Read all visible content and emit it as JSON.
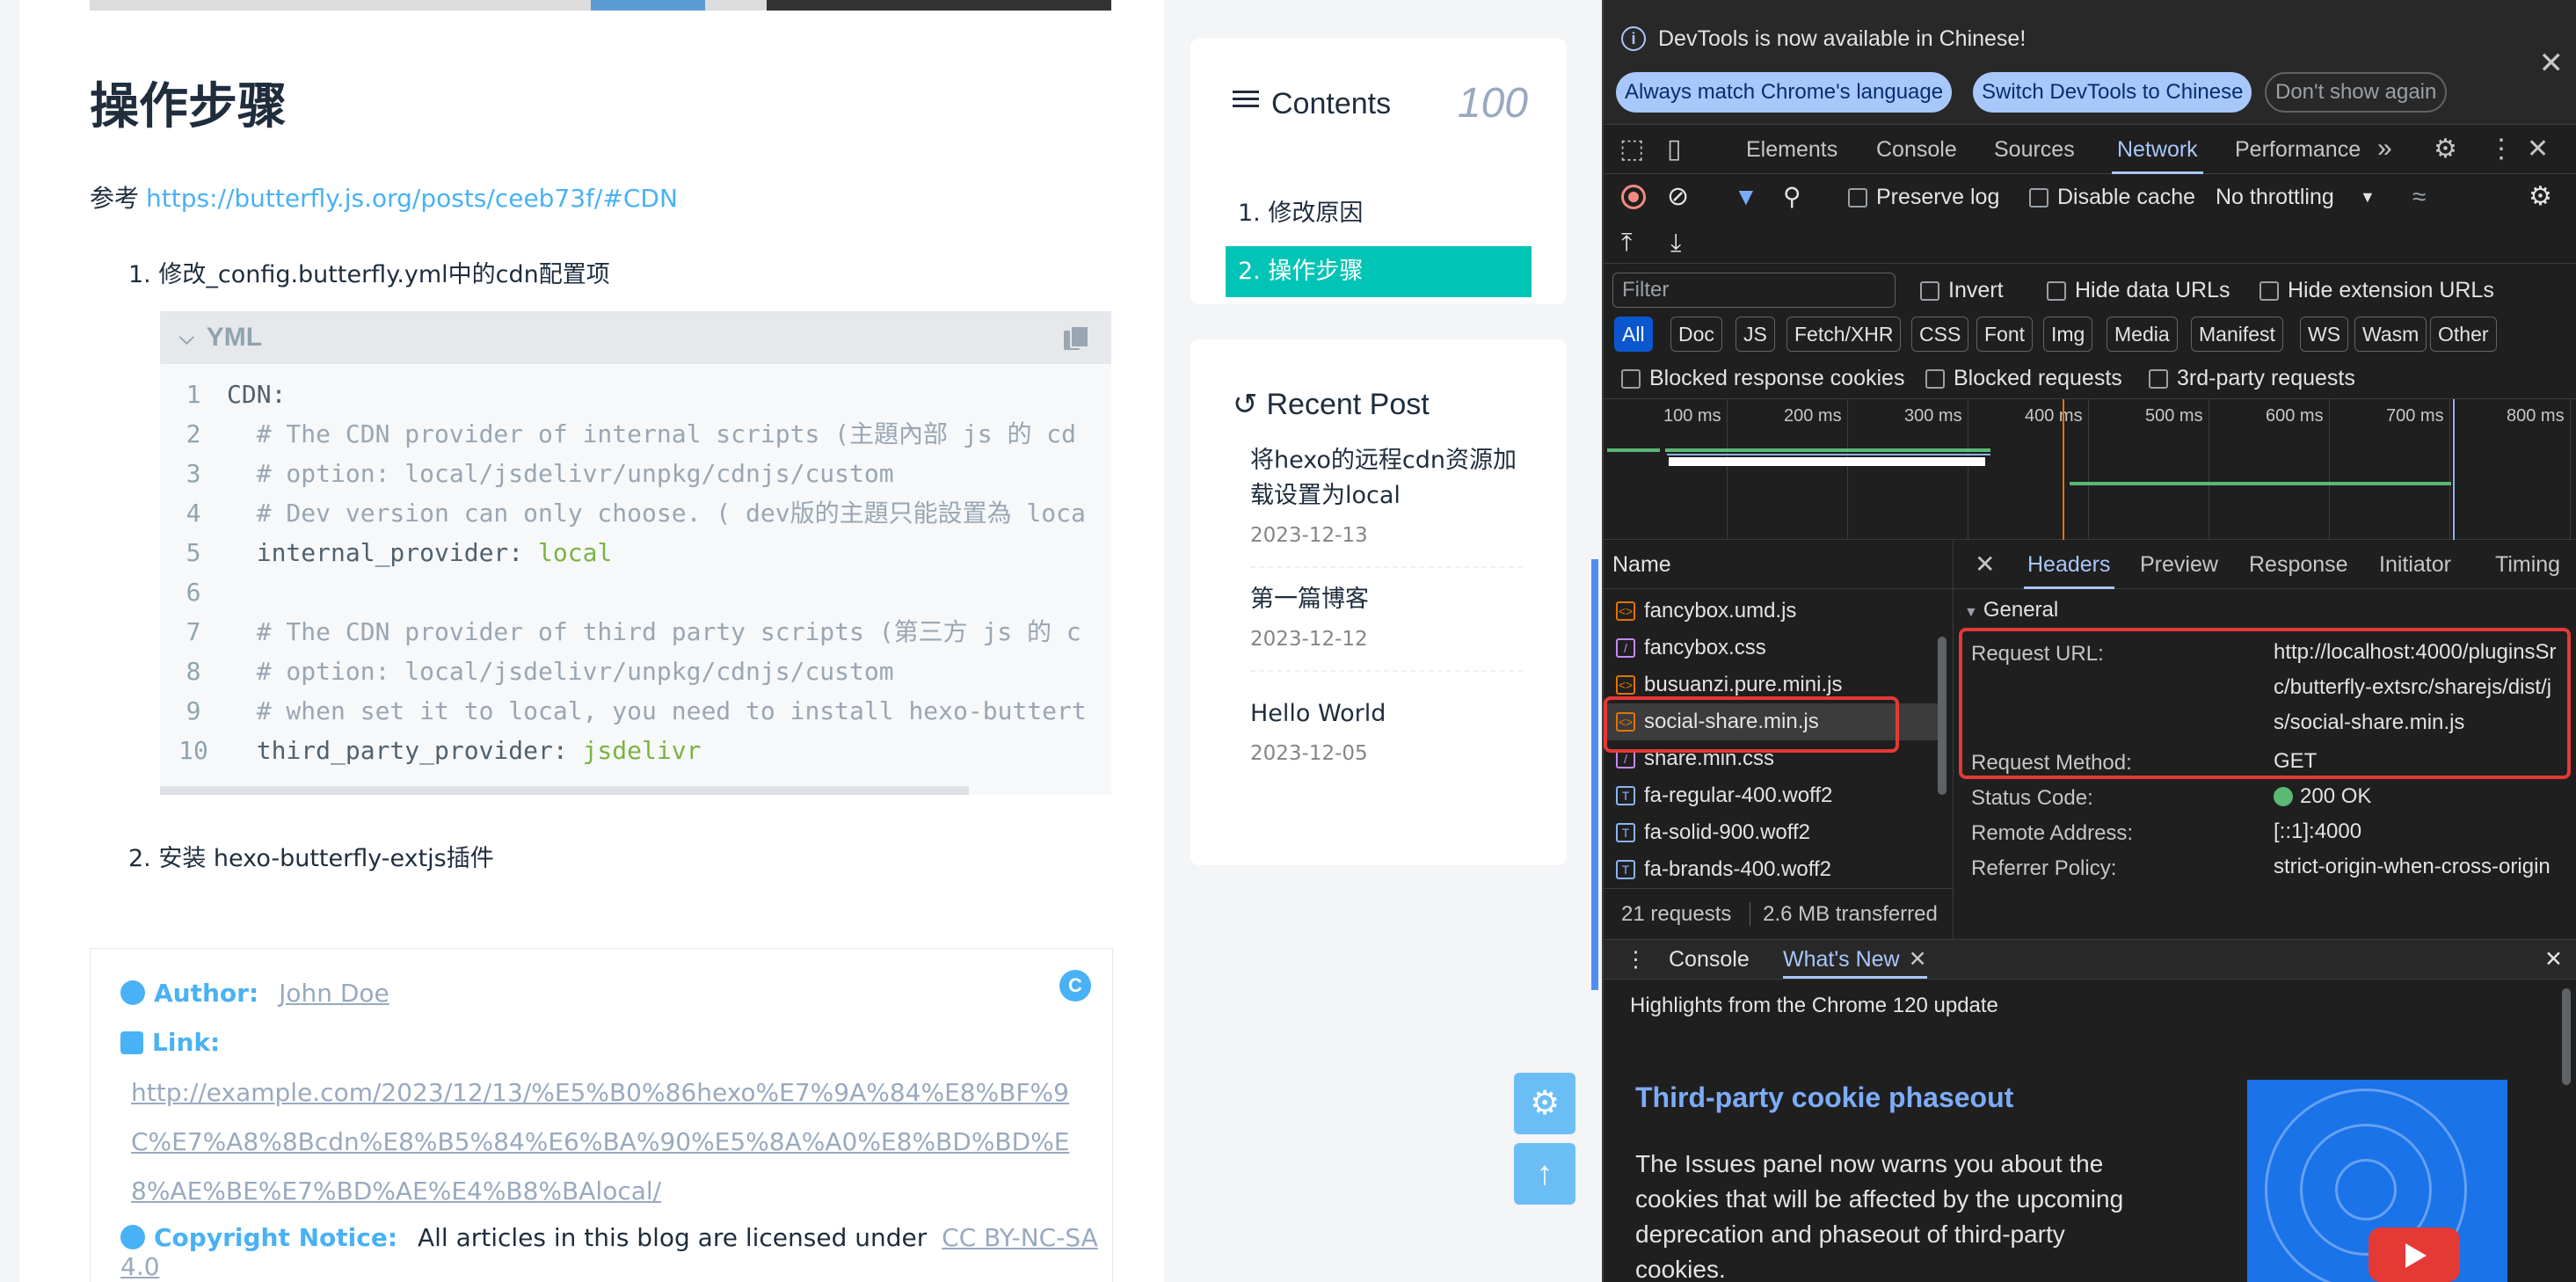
{
  "blog": {
    "heading": "操作步骤",
    "ref_prefix": "参考",
    "ref_link": "https://butterfly.js.org/posts/ceeb73f/#CDN",
    "step1": "1. 修改_config.butterfly.yml中的cdn配置项",
    "step2": "2. 安装 hexo-butterfly-extjs插件",
    "code": {
      "lang": "YML",
      "lines": [
        {
          "n": "1",
          "text": "CDN:"
        },
        {
          "n": "2",
          "text": "  # The CDN provider of internal scripts (主題內部 js 的 cd"
        },
        {
          "n": "3",
          "text": "  # option: local/jsdelivr/unpkg/cdnjs/custom"
        },
        {
          "n": "4",
          "text": "  # Dev version can only choose. ( dev版的主題只能設置為 loca"
        },
        {
          "n": "5",
          "key": "  internal_provider: ",
          "val": "local"
        },
        {
          "n": "6",
          "text": ""
        },
        {
          "n": "7",
          "text": "  # The CDN provider of third party scripts (第三方 js 的 c"
        },
        {
          "n": "8",
          "text": "  # option: local/jsdelivr/unpkg/cdnjs/custom"
        },
        {
          "n": "9",
          "text": "  # when set it to local, you need to install hexo-buttert"
        },
        {
          "n": "10",
          "key": "  third_party_provider: ",
          "val": "jsdelivr"
        }
      ]
    },
    "author_label": "Author:",
    "author_name": "John Doe",
    "link_label": "Link:",
    "link_url": "http://example.com/2023/12/13/%E5%B0%86hexo%E7%9A%84%E8%BF%9C%E7%A8%8Bcdn%E8%B5%84%E6%BA%90%E5%8A%A0%E8%BD%BD%E8%AE%BE%E7%BD%AE%E4%B8%BAlocal/",
    "copyright_label": "Copyright Notice:",
    "copyright_text": "All articles in this blog are licensed under",
    "copyright_link": "CC BY-NC-SA 4.0"
  },
  "sidebar": {
    "toc_title": "Contents",
    "toc_percent": "100",
    "toc_items": [
      "1. 修改原因",
      "2. 操作步骤"
    ],
    "recent_title": "Recent Post",
    "posts": [
      {
        "title": "将hexo的远程cdn资源加载设置为local",
        "date": "2023-12-13"
      },
      {
        "title": "第一篇博客",
        "date": "2023-12-12"
      },
      {
        "title": "Hello World",
        "date": "2023-12-05"
      }
    ]
  },
  "devtools": {
    "info_msg": "DevTools is now available in Chinese!",
    "btn_match": "Always match Chrome's language",
    "btn_switch": "Switch DevTools to Chinese",
    "btn_dont": "Don't show again",
    "tabs": [
      "Elements",
      "Console",
      "Sources",
      "Network",
      "Performance"
    ],
    "active_tab": "Network",
    "preserve_log": "Preserve log",
    "disable_cache": "Disable cache",
    "throttling": "No throttling",
    "filter_placeholder": "Filter",
    "invert": "Invert",
    "hide_data_urls": "Hide data URLs",
    "hide_ext_urls": "Hide extension URLs",
    "types": [
      "All",
      "Doc",
      "JS",
      "Fetch/XHR",
      "CSS",
      "Font",
      "Img",
      "Media",
      "Manifest",
      "WS",
      "Wasm",
      "Other"
    ],
    "blocked_cookies": "Blocked response cookies",
    "blocked_requests": "Blocked requests",
    "third_party": "3rd-party requests",
    "ticks": [
      "100 ms",
      "200 ms",
      "300 ms",
      "400 ms",
      "500 ms",
      "600 ms",
      "700 ms",
      "800 ms"
    ],
    "name_col": "Name",
    "requests": [
      {
        "name": "fancybox.umd.js",
        "type": "js"
      },
      {
        "name": "fancybox.css",
        "type": "css"
      },
      {
        "name": "busuanzi.pure.mini.js",
        "type": "js"
      },
      {
        "name": "social-share.min.js",
        "type": "js"
      },
      {
        "name": "share.min.css",
        "type": "css"
      },
      {
        "name": "fa-regular-400.woff2",
        "type": "font"
      },
      {
        "name": "fa-solid-900.woff2",
        "type": "font"
      },
      {
        "name": "fa-brands-400.woff2",
        "type": "font"
      }
    ],
    "summary_requests": "21 requests",
    "summary_transferred": "2.6 MB transferred",
    "hdr_tabs": [
      "Headers",
      "Preview",
      "Response",
      "Initiator",
      "Timing"
    ],
    "general": "General",
    "kv": [
      {
        "k": "Request URL:",
        "v": "http://localhost:4000/pluginsSrc/butterfly-extsrc/sharejs/dist/js/social-share.min.js"
      },
      {
        "k": "Request Method:",
        "v": "GET"
      },
      {
        "k": "Status Code:",
        "v": "200 OK"
      },
      {
        "k": "Remote Address:",
        "v": "[::1]:4000"
      },
      {
        "k": "Referrer Policy:",
        "v": "strict-origin-when-cross-origin"
      }
    ],
    "drawer_console": "Console",
    "drawer_whatsnew": "What's New",
    "wn_highlight": "Highlights from the Chrome 120 update",
    "wn_title": "Third-party cookie phaseout",
    "wn_body": "The Issues panel now warns you about the cookies that will be affected by the upcoming deprecation and phaseout of third-party cookies."
  }
}
